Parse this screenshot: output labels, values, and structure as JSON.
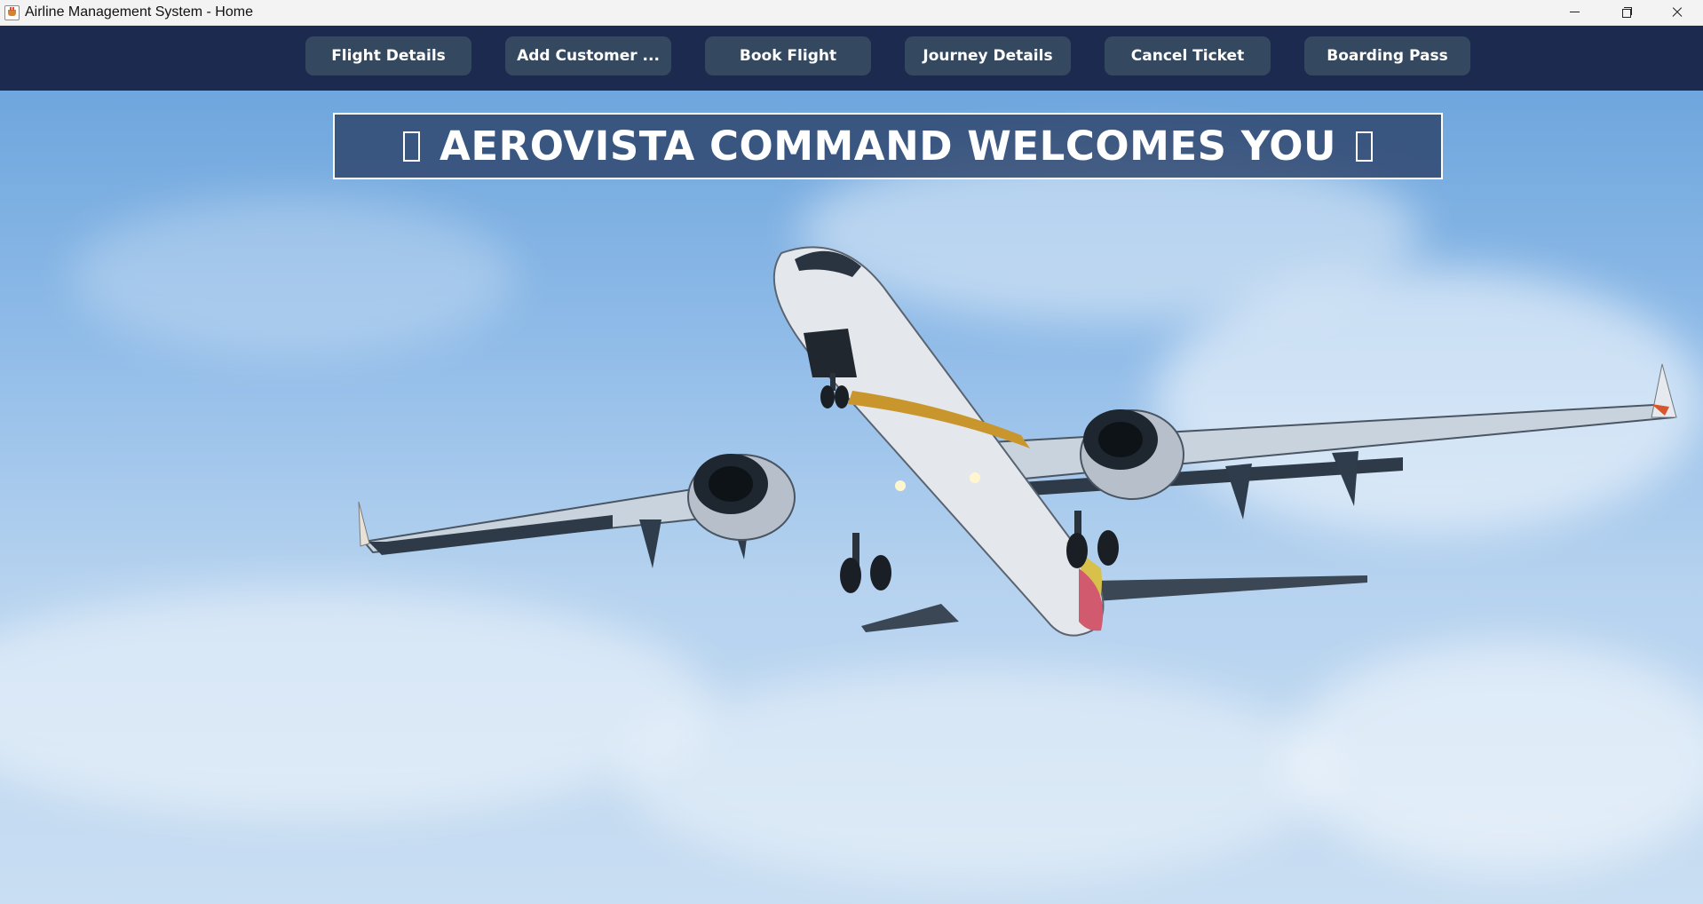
{
  "window": {
    "title": "Airline Management System - Home",
    "controls": [
      "minimize-icon",
      "restore-icon",
      "close-icon"
    ]
  },
  "nav": {
    "buttons": [
      "Flight Details",
      "Add Customer ...",
      "Book Flight",
      "Journey Details",
      "Cancel Ticket",
      "Boarding Pass"
    ]
  },
  "banner": {
    "text": "AEROVISTA COMMAND WELCOMES YOU",
    "left_glyph": "missing-glyph-box",
    "right_glyph": "missing-glyph-box"
  },
  "background": {
    "image": "airplane-in-sky-photo"
  },
  "colors": {
    "nav_bar": "#1b2a4e",
    "nav_button": "#34495f",
    "banner_bg": "#2c436b",
    "sky": "#8fbbe8"
  }
}
